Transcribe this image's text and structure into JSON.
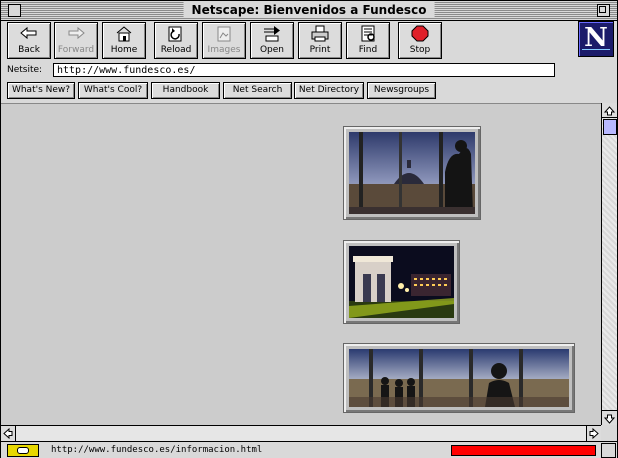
{
  "window": {
    "title": "Netscape: Bienvenidos a Fundesco"
  },
  "toolbar": {
    "buttons": [
      {
        "label": "Back",
        "icon": "back-arrow-icon",
        "enabled": true
      },
      {
        "label": "Forward",
        "icon": "forward-arrow-icon",
        "enabled": false
      },
      {
        "label": "Home",
        "icon": "home-icon",
        "enabled": true
      },
      {
        "label": "Reload",
        "icon": "reload-icon",
        "enabled": true
      },
      {
        "label": "Images",
        "icon": "images-icon",
        "enabled": false
      },
      {
        "label": "Open",
        "icon": "open-icon",
        "enabled": true
      },
      {
        "label": "Print",
        "icon": "print-icon",
        "enabled": true
      },
      {
        "label": "Find",
        "icon": "find-icon",
        "enabled": true
      },
      {
        "label": "Stop",
        "icon": "stop-icon",
        "enabled": true
      }
    ],
    "logo": "N"
  },
  "location": {
    "label": "Netsite:",
    "value": "http://www.fundesco.es/"
  },
  "directory": {
    "buttons": [
      "What's New?",
      "What's Cool?",
      "Handbook",
      "Net Search",
      "Net Directory",
      "Newsgroups"
    ]
  },
  "content": {
    "images": [
      "photo-statue-window",
      "photo-monument-night",
      "photo-silhouettes-window"
    ]
  },
  "status": {
    "message": "http://www.fundesco.es/informacion.html",
    "progress_color": "#ff0000"
  },
  "colors": {
    "content_bg": "#cccccc",
    "chrome_bg": "#d9d9d9",
    "stop_red": "#e0202a",
    "logo_blue": "#1b1b6a"
  }
}
